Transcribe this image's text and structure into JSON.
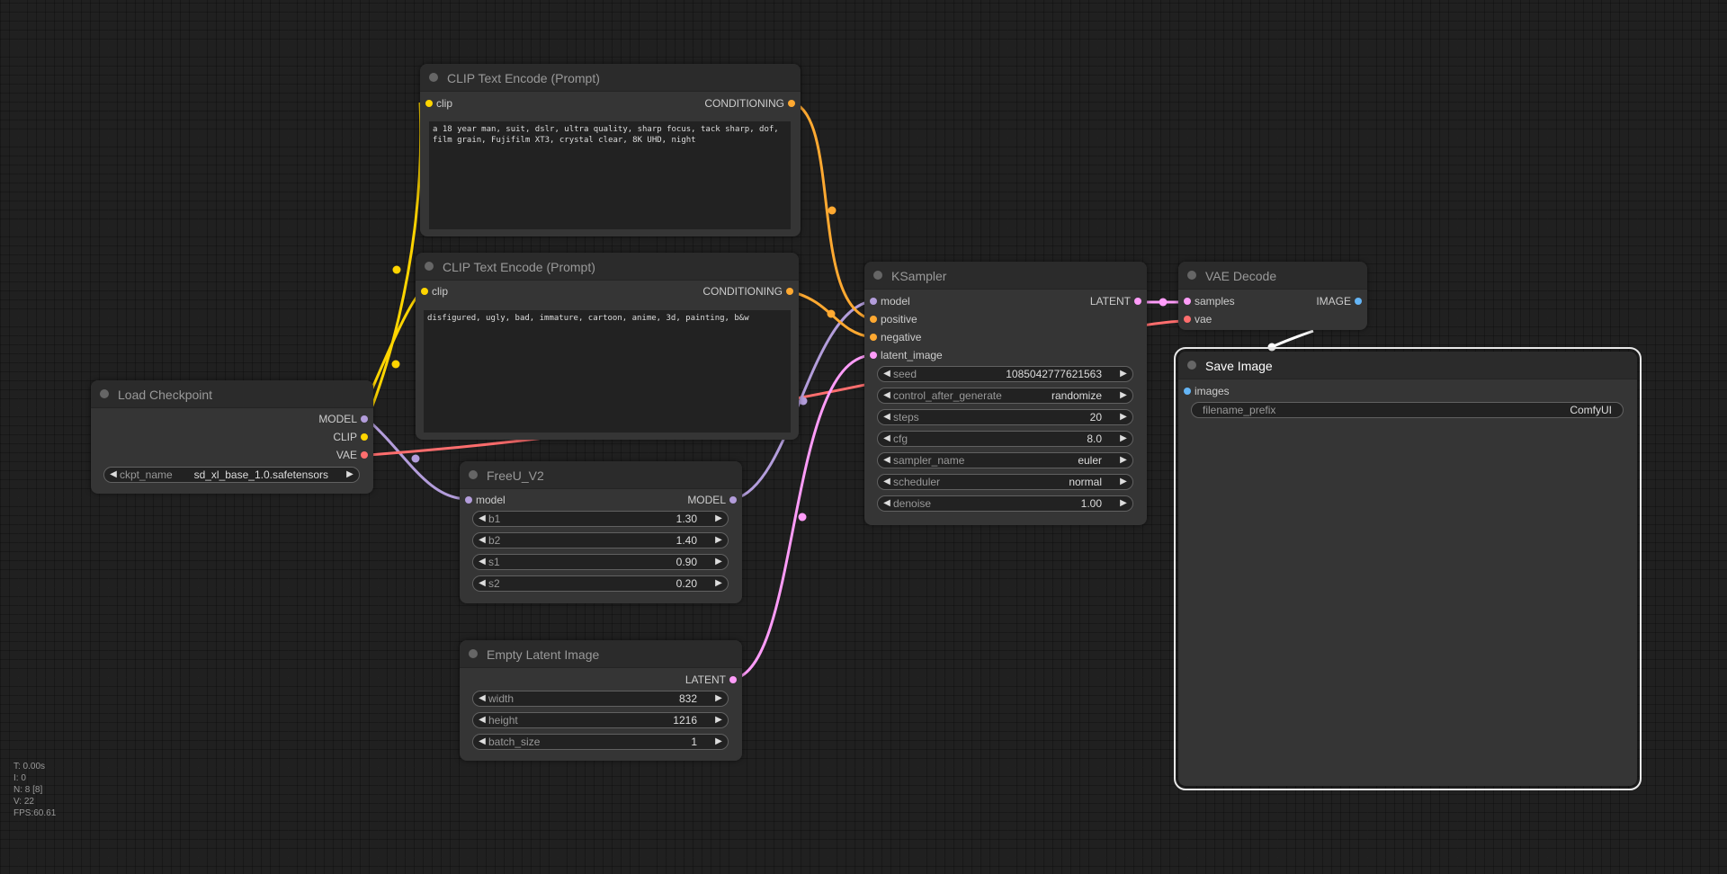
{
  "colors": {
    "clip": "#ffd500",
    "conditioning": "#ffa931",
    "model": "#b39ddb",
    "vae": "#ff6e6e",
    "latent": "#ff9cf9",
    "image": "#64b5f6"
  },
  "nodes": {
    "clip_pos": {
      "title": "CLIP Text Encode (Prompt)",
      "in_clip": "clip",
      "out_conditioning": "CONDITIONING",
      "text": "a 18 year man, suit, dslr, ultra quality, sharp focus, tack sharp, dof, film grain, Fujifilm XT3, crystal clear, 8K UHD, night"
    },
    "clip_neg": {
      "title": "CLIP Text Encode (Prompt)",
      "in_clip": "clip",
      "out_conditioning": "CONDITIONING",
      "text": "disfigured, ugly, bad, immature, cartoon, anime, 3d, painting, b&w"
    },
    "checkpoint": {
      "title": "Load Checkpoint",
      "out_model": "MODEL",
      "out_clip": "CLIP",
      "out_vae": "VAE",
      "ckpt_label": "ckpt_name",
      "ckpt_value": "sd_xl_base_1.0.safetensors"
    },
    "freeu": {
      "title": "FreeU_V2",
      "in_model": "model",
      "out_model": "MODEL",
      "widgets": [
        {
          "label": "b1",
          "value": "1.30"
        },
        {
          "label": "b2",
          "value": "1.40"
        },
        {
          "label": "s1",
          "value": "0.90"
        },
        {
          "label": "s2",
          "value": "0.20"
        }
      ]
    },
    "latent": {
      "title": "Empty Latent Image",
      "out_latent": "LATENT",
      "widgets": [
        {
          "label": "width",
          "value": "832"
        },
        {
          "label": "height",
          "value": "1216"
        },
        {
          "label": "batch_size",
          "value": "1"
        }
      ]
    },
    "ksampler": {
      "title": "KSampler",
      "in_model": "model",
      "in_positive": "positive",
      "in_negative": "negative",
      "in_latent": "latent_image",
      "out_latent": "LATENT",
      "widgets": [
        {
          "label": "seed",
          "value": "1085042777621563"
        },
        {
          "label": "control_after_generate",
          "value": "randomize"
        },
        {
          "label": "steps",
          "value": "20"
        },
        {
          "label": "cfg",
          "value": "8.0"
        },
        {
          "label": "sampler_name",
          "value": "euler"
        },
        {
          "label": "scheduler",
          "value": "normal"
        },
        {
          "label": "denoise",
          "value": "1.00"
        }
      ]
    },
    "vaedecode": {
      "title": "VAE Decode",
      "in_samples": "samples",
      "in_vae": "vae",
      "out_image": "IMAGE"
    },
    "save": {
      "title": "Save Image",
      "in_images": "images",
      "prefix_label": "filename_prefix",
      "prefix_value": "ComfyUI"
    }
  },
  "stats": {
    "t": "T: 0.00s",
    "i": "I: 0",
    "n": "N: 8 [8]",
    "v": "V: 22",
    "fps": "FPS:60.61"
  }
}
